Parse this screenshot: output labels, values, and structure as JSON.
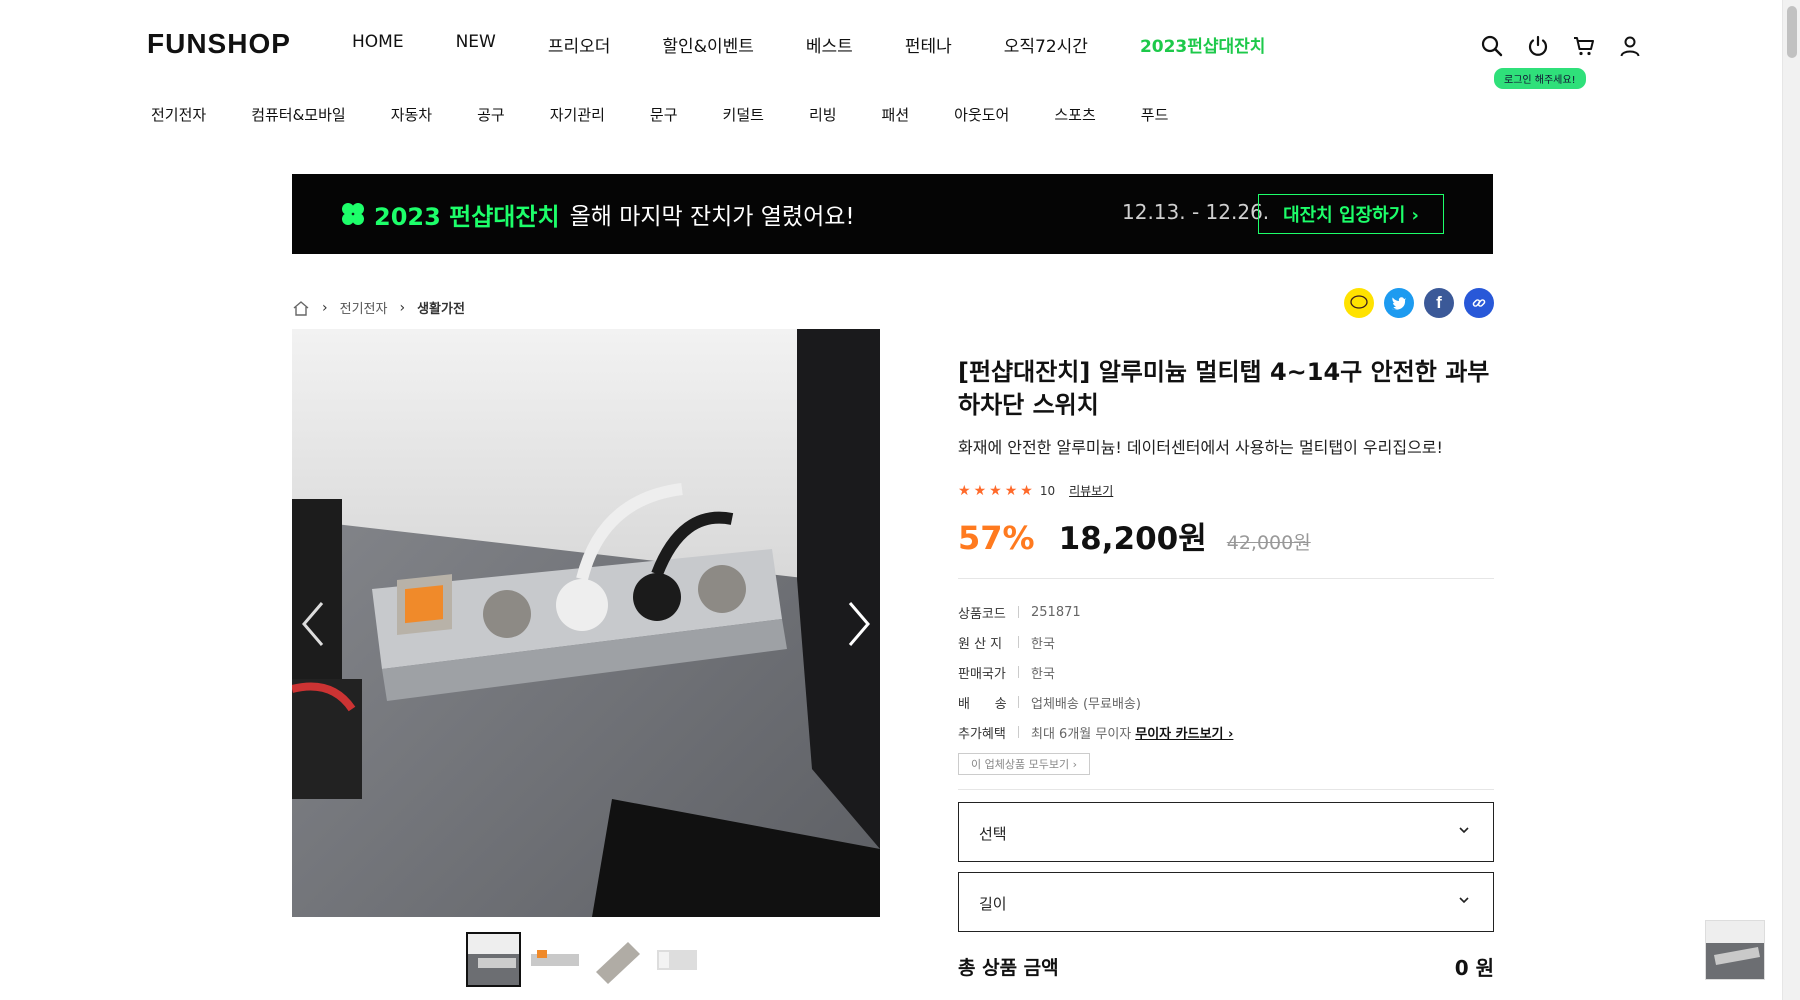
{
  "header": {
    "logo": "FUNSHOP",
    "nav": [
      "HOME",
      "NEW",
      "프리오더",
      "할인&이벤트",
      "베스트",
      "펀테나",
      "오직72시간",
      "2023펀샵대잔치"
    ],
    "nav_highlight_index": 7,
    "login_tip": "로그인 해주세요!",
    "icons": [
      "search-icon",
      "power-icon",
      "cart-icon",
      "user-icon"
    ],
    "highlight_color": "#1dc94a"
  },
  "categories": [
    "전기전자",
    "컴퓨터&모바일",
    "자동차",
    "공구",
    "자기관리",
    "문구",
    "키덜트",
    "리빙",
    "패션",
    "아웃도어",
    "스포츠",
    "푸드"
  ],
  "banner": {
    "title": "2023 펀샵대잔치",
    "subtitle": "올해 마지막 잔치가 열렸어요!",
    "date": "12.13. - 12.26.",
    "button": "대잔치 입장하기 ›",
    "accent": "#1dff6a"
  },
  "breadcrumb": {
    "items": [
      "전기전자",
      "생활가전"
    ]
  },
  "share": [
    "kakaotalk-icon",
    "twitter-icon",
    "facebook-icon",
    "link-icon"
  ],
  "product": {
    "title": "[펀샵대잔치] 알루미늄 멀티탭 4~14구 안전한 과부하차단 스위치",
    "description": "화재에 안전한 알루미늄! 데이터센터에서 사용하는 멀티탭이 우리집으로!",
    "rating_stars": 5,
    "review_count": "10",
    "review_link": "리뷰보기",
    "discount": "57%",
    "price": "18,200원",
    "original_price": "42,000원",
    "specs": [
      {
        "label": "상품코드",
        "value": "251871"
      },
      {
        "label": "원 산 지",
        "value": "한국"
      },
      {
        "label": "판매국가",
        "value": "한국"
      },
      {
        "label": "배      송",
        "value": "업체배송 (무료배송)"
      },
      {
        "label": "추가혜택",
        "value": "최대 6개월 무이자",
        "link": "무이자 카드보기 ›"
      }
    ],
    "all_items_button": "이 업체상품 모두보기 ›",
    "options": [
      {
        "label": "선택"
      },
      {
        "label": "길이"
      }
    ],
    "total_label": "총 상품 금액",
    "total_value": "0 원",
    "discount_color": "#ff7a1f"
  }
}
